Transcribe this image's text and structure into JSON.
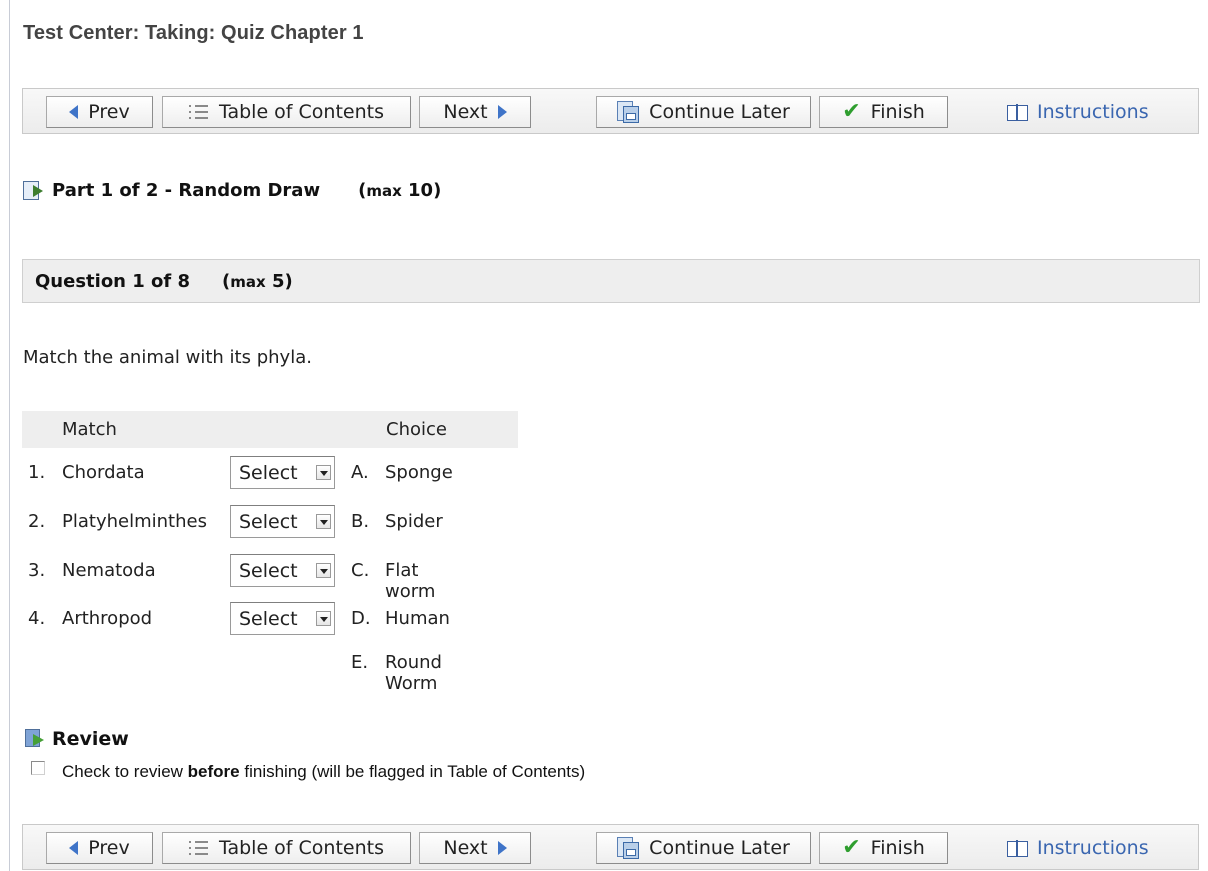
{
  "page": {
    "title": "Test Center: Taking: Quiz Chapter 1"
  },
  "toolbar": {
    "prev": "Prev",
    "toc": "Table of Contents",
    "next": "Next",
    "continue_later": "Continue Later",
    "finish": "Finish",
    "instructions": "Instructions",
    "instructions_color": "#3a66b0",
    "icons": {
      "prev": "left-arrow-icon",
      "toc": "list-icon",
      "next": "right-arrow-icon",
      "continue_later": "save-icon",
      "finish": "checkmark-icon",
      "instructions": "book-icon"
    }
  },
  "part": {
    "heading": "Part 1 of 2 - Random Draw",
    "max_word": "max",
    "max_value": "10"
  },
  "question": {
    "heading": "Question 1 of 8",
    "max_word": "max",
    "max_value": "5",
    "text": "Match the animal with its phyla.",
    "col_match": "Match",
    "col_choice": "Choice",
    "matches": [
      {
        "num": "1.",
        "term": "Chordata",
        "selected": "Select"
      },
      {
        "num": "2.",
        "term": "Platyhelminthes",
        "selected": "Select"
      },
      {
        "num": "3.",
        "term": "Nematoda",
        "selected": "Select"
      },
      {
        "num": "4.",
        "term": "Arthropod",
        "selected": "Select"
      }
    ],
    "choices": [
      {
        "letter": "A.",
        "text": "Sponge"
      },
      {
        "letter": "B.",
        "text": "Spider"
      },
      {
        "letter": "C.",
        "text": "Flat worm"
      },
      {
        "letter": "D.",
        "text": "Human"
      },
      {
        "letter": "E.",
        "text": "Round Worm"
      }
    ]
  },
  "review": {
    "heading": "Review",
    "label_pre": "Check to review ",
    "label_bold": "before",
    "label_post": " finishing (will be flagged in Table of Contents)",
    "checked": false
  }
}
